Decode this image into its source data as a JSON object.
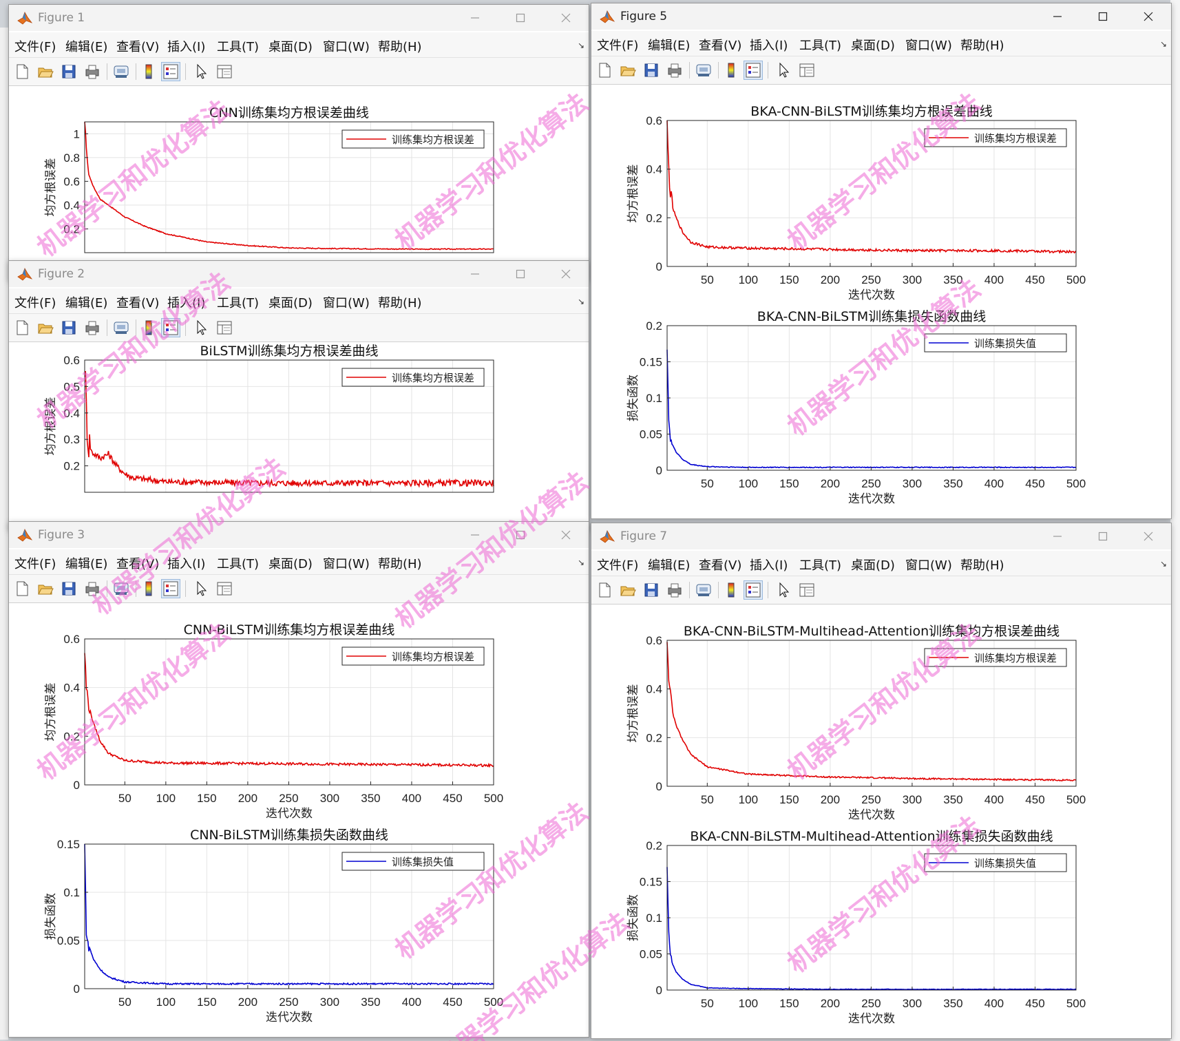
{
  "menu": [
    "文件(F)",
    "编辑(E)",
    "查看(V)",
    "插入(I)",
    "工具(T)",
    "桌面(D)",
    "窗口(W)",
    "帮助(H)"
  ],
  "watermark": "机器学习和优化算法",
  "colors": {
    "rmse": "#e00000",
    "loss": "#0000d0",
    "watermark": "#ec68d4"
  },
  "toolbar_icons": [
    "new-figure-icon",
    "open-icon",
    "save-icon",
    "print-icon",
    "link-icon",
    "colorbar-icon",
    "legend-icon",
    "pointer-icon",
    "property-inspector-icon"
  ],
  "windows": [
    {
      "id": "fig1",
      "title": "Figure 1",
      "active": false
    },
    {
      "id": "fig2",
      "title": "Figure 2",
      "active": false
    },
    {
      "id": "fig3",
      "title": "Figure 3",
      "active": false
    },
    {
      "id": "fig5",
      "title": "Figure 5",
      "active": true
    },
    {
      "id": "fig7",
      "title": "Figure 7",
      "active": false
    }
  ],
  "chart_data": [
    {
      "window": "Figure 1",
      "type": "line",
      "title": "CNN训练集均方根误差曲线",
      "ylabel": "均方根误差",
      "xlabel": "",
      "xlim": [
        1,
        500
      ],
      "ylim": [
        0,
        1.1
      ],
      "yticks": [
        "0.2",
        "0.4",
        "0.6",
        "0.8",
        "1"
      ],
      "xticks": [],
      "grid": true,
      "legend_position": "top-right",
      "series": [
        {
          "name": "训练集均方根误差",
          "color": "#e00000",
          "points": [
            [
              1,
              1.1
            ],
            [
              3,
              0.9
            ],
            [
              5,
              0.7
            ],
            [
              8,
              0.62
            ],
            [
              12,
              0.55
            ],
            [
              20,
              0.45
            ],
            [
              30,
              0.4
            ],
            [
              50,
              0.3
            ],
            [
              75,
              0.22
            ],
            [
              100,
              0.16
            ],
            [
              150,
              0.09
            ],
            [
              200,
              0.06
            ],
            [
              250,
              0.04
            ],
            [
              300,
              0.035
            ],
            [
              400,
              0.03
            ],
            [
              500,
              0.03
            ]
          ],
          "noise": 0.004
        }
      ]
    },
    {
      "window": "Figure 2",
      "type": "line",
      "title": "BiLSTM训练集均方根误差曲线",
      "ylabel": "均方根误差",
      "xlabel": "",
      "xlim": [
        1,
        500
      ],
      "ylim": [
        0.1,
        0.6
      ],
      "yticks": [
        "0.2",
        "0.3",
        "0.4",
        "0.5",
        "0.6"
      ],
      "xticks": [],
      "grid": true,
      "legend_position": "top-right",
      "series": [
        {
          "name": "训练集均方根误差",
          "color": "#e00000",
          "points": [
            [
              1,
              0.6
            ],
            [
              3,
              0.42
            ],
            [
              5,
              0.3
            ],
            [
              10,
              0.25
            ],
            [
              20,
              0.23
            ],
            [
              30,
              0.245
            ],
            [
              40,
              0.2
            ],
            [
              50,
              0.17
            ],
            [
              60,
              0.155
            ],
            [
              100,
              0.14
            ],
            [
              200,
              0.135
            ],
            [
              300,
              0.135
            ],
            [
              400,
              0.135
            ],
            [
              500,
              0.135
            ]
          ],
          "noise": 0.012
        }
      ]
    },
    {
      "window": "Figure 3",
      "type": "line",
      "title": "CNN-BiLSTM训练集均方根误差曲线",
      "ylabel": "均方根误差",
      "xlabel": "迭代次数",
      "xlim": [
        1,
        500
      ],
      "ylim": [
        0,
        0.6
      ],
      "yticks": [
        "0",
        "0.2",
        "0.4",
        "0.6"
      ],
      "xticks": [
        "50",
        "100",
        "150",
        "200",
        "250",
        "300",
        "350",
        "400",
        "450",
        "500"
      ],
      "grid": true,
      "legend_position": "top-right",
      "series": [
        {
          "name": "训练集均方根误差",
          "color": "#e00000",
          "points": [
            [
              1,
              0.55
            ],
            [
              3,
              0.4
            ],
            [
              5,
              0.35
            ],
            [
              8,
              0.3
            ],
            [
              12,
              0.25
            ],
            [
              20,
              0.18
            ],
            [
              30,
              0.13
            ],
            [
              50,
              0.1
            ],
            [
              100,
              0.09
            ],
            [
              200,
              0.088
            ],
            [
              300,
              0.085
            ],
            [
              400,
              0.083
            ],
            [
              500,
              0.08
            ]
          ],
          "noise": 0.005
        }
      ]
    },
    {
      "window": "Figure 3",
      "type": "line",
      "title": "CNN-BiLSTM训练集损失函数曲线",
      "ylabel": "损失函数",
      "xlabel": "迭代次数",
      "xlim": [
        1,
        500
      ],
      "ylim": [
        0,
        0.15
      ],
      "yticks": [
        "0",
        "0.05",
        "0.1",
        "0.15"
      ],
      "xticks": [
        "50",
        "100",
        "150",
        "200",
        "250",
        "300",
        "350",
        "400",
        "450",
        "500"
      ],
      "grid": true,
      "legend_position": "top-right",
      "series": [
        {
          "name": "训练集损失值",
          "color": "#0000d0",
          "points": [
            [
              1,
              0.15
            ],
            [
              3,
              0.06
            ],
            [
              5,
              0.045
            ],
            [
              8,
              0.04
            ],
            [
              12,
              0.03
            ],
            [
              20,
              0.02
            ],
            [
              30,
              0.012
            ],
            [
              50,
              0.007
            ],
            [
              100,
              0.005
            ],
            [
              200,
              0.005
            ],
            [
              300,
              0.005
            ],
            [
              500,
              0.005
            ]
          ],
          "noise": 0.0008
        }
      ]
    },
    {
      "window": "Figure 5",
      "type": "line",
      "title": "BKA-CNN-BiLSTM训练集均方根误差曲线",
      "ylabel": "均方根误差",
      "xlabel": "迭代次数",
      "xlim": [
        1,
        500
      ],
      "ylim": [
        0,
        0.6
      ],
      "yticks": [
        "0",
        "0.2",
        "0.4",
        "0.6"
      ],
      "xticks": [
        "50",
        "100",
        "150",
        "200",
        "250",
        "300",
        "350",
        "400",
        "450",
        "500"
      ],
      "grid": true,
      "legend_position": "top-right",
      "series": [
        {
          "name": "训练集均方根误差",
          "color": "#e00000",
          "points": [
            [
              1,
              0.58
            ],
            [
              3,
              0.4
            ],
            [
              5,
              0.3
            ],
            [
              8,
              0.24
            ],
            [
              12,
              0.2
            ],
            [
              20,
              0.14
            ],
            [
              30,
              0.1
            ],
            [
              50,
              0.08
            ],
            [
              100,
              0.075
            ],
            [
              200,
              0.07
            ],
            [
              300,
              0.065
            ],
            [
              400,
              0.065
            ],
            [
              500,
              0.06
            ]
          ],
          "noise": 0.005
        }
      ]
    },
    {
      "window": "Figure 5",
      "type": "line",
      "title": "BKA-CNN-BiLSTM训练集损失函数曲线",
      "ylabel": "损失函数",
      "xlabel": "迭代次数",
      "xlim": [
        1,
        500
      ],
      "ylim": [
        0,
        0.2
      ],
      "yticks": [
        "0",
        "0.05",
        "0.1",
        "0.15",
        "0.2"
      ],
      "xticks": [
        "50",
        "100",
        "150",
        "200",
        "250",
        "300",
        "350",
        "400",
        "450",
        "500"
      ],
      "grid": true,
      "legend_position": "top-right",
      "series": [
        {
          "name": "训练集损失值",
          "color": "#0000d0",
          "points": [
            [
              1,
              0.17
            ],
            [
              3,
              0.07
            ],
            [
              5,
              0.04
            ],
            [
              8,
              0.035
            ],
            [
              12,
              0.025
            ],
            [
              20,
              0.015
            ],
            [
              30,
              0.008
            ],
            [
              50,
              0.005
            ],
            [
              100,
              0.004
            ],
            [
              200,
              0.004
            ],
            [
              300,
              0.004
            ],
            [
              500,
              0.004
            ]
          ],
          "noise": 0.0006
        }
      ]
    },
    {
      "window": "Figure 7",
      "type": "line",
      "title": "BKA-CNN-BiLSTM-Multihead-Attention训练集均方根误差曲线",
      "ylabel": "均方根误差",
      "xlabel": "迭代次数",
      "xlim": [
        1,
        500
      ],
      "ylim": [
        0,
        0.6
      ],
      "yticks": [
        "0",
        "0.2",
        "0.4",
        "0.6"
      ],
      "xticks": [
        "50",
        "100",
        "150",
        "200",
        "250",
        "300",
        "350",
        "400",
        "450",
        "500"
      ],
      "grid": true,
      "legend_position": "top-right",
      "series": [
        {
          "name": "训练集均方根误差",
          "color": "#e00000",
          "points": [
            [
              1,
              0.6
            ],
            [
              3,
              0.45
            ],
            [
              5,
              0.38
            ],
            [
              8,
              0.3
            ],
            [
              12,
              0.25
            ],
            [
              20,
              0.19
            ],
            [
              30,
              0.13
            ],
            [
              50,
              0.08
            ],
            [
              100,
              0.05
            ],
            [
              200,
              0.038
            ],
            [
              300,
              0.032
            ],
            [
              400,
              0.028
            ],
            [
              500,
              0.025
            ]
          ],
          "noise": 0.003
        }
      ]
    },
    {
      "window": "Figure 7",
      "type": "line",
      "title": "BKA-CNN-BiLSTM-Multihead-Attention训练集损失函数曲线",
      "ylabel": "损失函数",
      "xlabel": "迭代次数",
      "xlim": [
        1,
        500
      ],
      "ylim": [
        0,
        0.2
      ],
      "yticks": [
        "0",
        "0.05",
        "0.1",
        "0.15",
        "0.2"
      ],
      "xticks": [
        "50",
        "100",
        "150",
        "200",
        "250",
        "300",
        "350",
        "400",
        "450",
        "500"
      ],
      "grid": true,
      "legend_position": "top-right",
      "series": [
        {
          "name": "训练集损失值",
          "color": "#0000d0",
          "points": [
            [
              1,
              0.17
            ],
            [
              3,
              0.08
            ],
            [
              5,
              0.05
            ],
            [
              8,
              0.035
            ],
            [
              12,
              0.025
            ],
            [
              20,
              0.015
            ],
            [
              30,
              0.008
            ],
            [
              50,
              0.003
            ],
            [
              100,
              0.002
            ],
            [
              200,
              0.001
            ],
            [
              300,
              0.001
            ],
            [
              500,
              0.001
            ]
          ],
          "noise": 0.0004
        }
      ]
    }
  ]
}
